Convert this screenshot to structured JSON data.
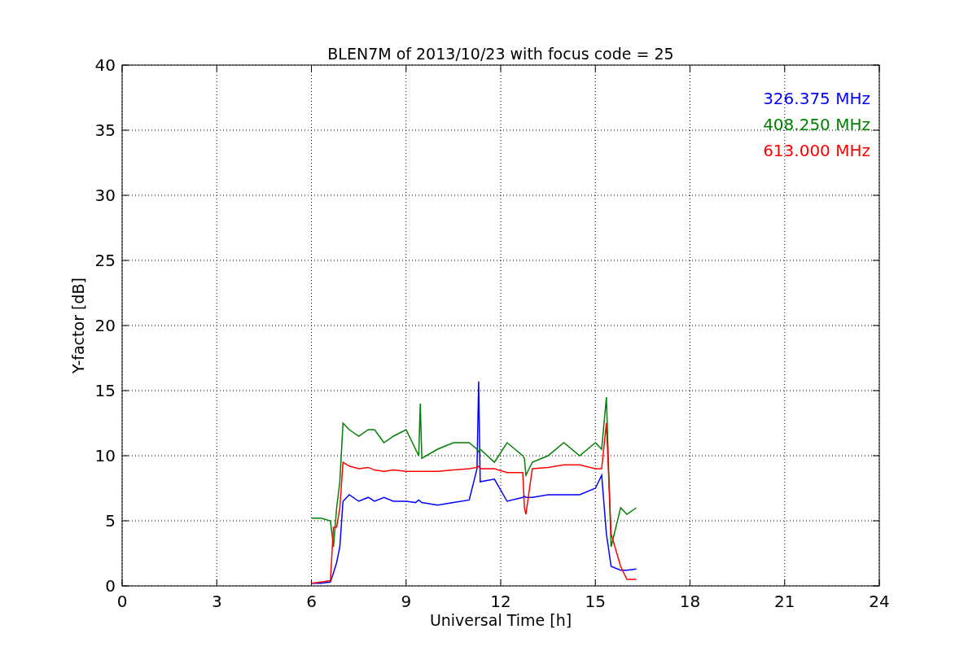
{
  "figure": {
    "chart_data": {
      "type": "line",
      "title": "BLEN7M of 2013/10/23 with focus code = 25",
      "xlabel": "Universal Time [h]",
      "ylabel": "Y-factor [dB]",
      "xlim": [
        0,
        24
      ],
      "ylim": [
        0,
        40
      ],
      "xticks": [
        0,
        3,
        6,
        9,
        12,
        15,
        18,
        21,
        24
      ],
      "yticks": [
        0,
        5,
        10,
        15,
        20,
        25,
        30,
        35,
        40
      ],
      "grid": true,
      "x": [
        6.0,
        6.3,
        6.6,
        6.7,
        6.8,
        6.9,
        7.0,
        7.2,
        7.5,
        7.8,
        8.0,
        8.3,
        8.6,
        9.0,
        9.3,
        9.4,
        9.45,
        9.5,
        10,
        10.5,
        11,
        11.25,
        11.3,
        11.35,
        11.8,
        12.2,
        12.7,
        12.75,
        12.8,
        13,
        13.5,
        14,
        14.5,
        15,
        15.2,
        15.35,
        15.5,
        15.8,
        16.0,
        16.3
      ],
      "series": [
        {
          "name": "326.375 MHz",
          "color": "#0000ff",
          "values": [
            0.2,
            0.2,
            0.3,
            1,
            1.8,
            3,
            6.5,
            7,
            6.5,
            6.8,
            6.5,
            6.8,
            6.5,
            6.5,
            6.4,
            6.6,
            6.5,
            6.4,
            6.2,
            6.4,
            6.6,
            9,
            15.7,
            8,
            8.2,
            6.5,
            6.8,
            6.9,
            6.8,
            6.8,
            7,
            7,
            7,
            7.5,
            8.5,
            4,
            1.5,
            1.2,
            1.2,
            1.3
          ]
        },
        {
          "name": "408.250 MHz",
          "color": "#008000",
          "values": [
            5.2,
            5.2,
            5,
            3,
            6,
            8,
            12.5,
            12,
            11.5,
            12,
            12,
            11,
            11.5,
            12,
            10.5,
            10,
            14,
            9.8,
            10.5,
            11,
            11,
            10.5,
            10.3,
            10.5,
            9.5,
            11,
            10,
            9.8,
            8.5,
            9.5,
            10,
            11,
            10,
            11,
            10.5,
            14.5,
            3,
            6,
            5.5,
            6
          ]
        },
        {
          "name": "613.000 MHz",
          "color": "#ff0000",
          "values": [
            0.2,
            0.3,
            0.4,
            4.5,
            4.5,
            6,
            9.5,
            9.2,
            9,
            9.1,
            8.9,
            8.8,
            8.9,
            8.8,
            8.8,
            8.8,
            8.8,
            8.8,
            8.8,
            8.9,
            9,
            9.1,
            9.2,
            9,
            9,
            8.7,
            8.7,
            6,
            5.5,
            9,
            9.1,
            9.3,
            9.3,
            9,
            9,
            12.5,
            4,
            1.5,
            0.5,
            0.5
          ]
        }
      ]
    }
  }
}
